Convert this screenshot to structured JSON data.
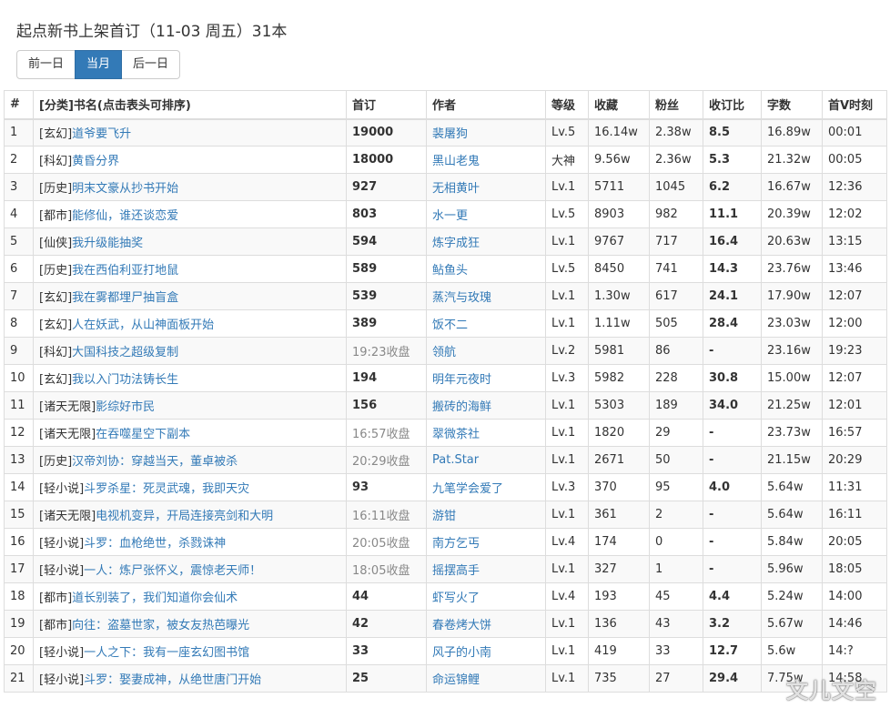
{
  "header": {
    "title": "起点新书上架首订（11-03 周五）31本"
  },
  "nav": {
    "prev_label": "前一日",
    "month_label": "当月",
    "next_label": "后一日"
  },
  "table": {
    "columns": [
      "#",
      "[分类]书名(点击表头可排序)",
      "首订",
      "作者",
      "等级",
      "收藏",
      "粉丝",
      "收订比",
      "字数",
      "首V时刻"
    ],
    "rows": [
      {
        "n": "1",
        "cat": "[玄幻]",
        "name": "道爷要飞升",
        "first": "19000",
        "closed": false,
        "author": "裴屠狗",
        "level": "Lv.5",
        "fav": "16.14w",
        "fans": "2.38w",
        "ratio": "8.5",
        "words": "16.89w",
        "time": "00:01"
      },
      {
        "n": "2",
        "cat": "[科幻]",
        "name": "黄昏分界",
        "first": "18000",
        "closed": false,
        "author": "黑山老鬼",
        "level": "大神",
        "fav": "9.56w",
        "fans": "2.36w",
        "ratio": "5.3",
        "words": "21.32w",
        "time": "00:05"
      },
      {
        "n": "3",
        "cat": "[历史]",
        "name": "明末文豪从抄书开始",
        "first": "927",
        "closed": false,
        "author": "无相黄叶",
        "level": "Lv.1",
        "fav": "5711",
        "fans": "1045",
        "ratio": "6.2",
        "words": "16.67w",
        "time": "12:36"
      },
      {
        "n": "4",
        "cat": "[都市]",
        "name": "能修仙，谁还谈恋爱",
        "first": "803",
        "closed": false,
        "author": "水一更",
        "level": "Lv.5",
        "fav": "8903",
        "fans": "982",
        "ratio": "11.1",
        "words": "20.39w",
        "time": "12:02"
      },
      {
        "n": "5",
        "cat": "[仙侠]",
        "name": "我升级能抽奖",
        "first": "594",
        "closed": false,
        "author": "炼字成狂",
        "level": "Lv.1",
        "fav": "9767",
        "fans": "717",
        "ratio": "16.4",
        "words": "20.63w",
        "time": "13:15"
      },
      {
        "n": "6",
        "cat": "[历史]",
        "name": "我在西伯利亚打地鼠",
        "first": "589",
        "closed": false,
        "author": "鲇鱼头",
        "level": "Lv.5",
        "fav": "8450",
        "fans": "741",
        "ratio": "14.3",
        "words": "23.76w",
        "time": "13:46"
      },
      {
        "n": "7",
        "cat": "[玄幻]",
        "name": "我在雾都埋尸抽盲盒",
        "first": "539",
        "closed": false,
        "author": "蒸汽与玫瑰",
        "level": "Lv.1",
        "fav": "1.30w",
        "fans": "617",
        "ratio": "24.1",
        "words": "17.90w",
        "time": "12:07"
      },
      {
        "n": "8",
        "cat": "[玄幻]",
        "name": "人在妖武，从山神面板开始",
        "first": "389",
        "closed": false,
        "author": "饭不二",
        "level": "Lv.1",
        "fav": "1.11w",
        "fans": "505",
        "ratio": "28.4",
        "words": "23.03w",
        "time": "12:00"
      },
      {
        "n": "9",
        "cat": "[科幻]",
        "name": "大国科技之超级复制",
        "first": "19:23收盘",
        "closed": true,
        "author": "领航",
        "level": "Lv.2",
        "fav": "5981",
        "fans": "86",
        "ratio": "-",
        "words": "23.16w",
        "time": "19:23"
      },
      {
        "n": "10",
        "cat": "[玄幻]",
        "name": "我以入门功法铸长生",
        "first": "194",
        "closed": false,
        "author": "明年元夜时",
        "level": "Lv.3",
        "fav": "5982",
        "fans": "228",
        "ratio": "30.8",
        "words": "15.00w",
        "time": "12:07"
      },
      {
        "n": "11",
        "cat": "[诸天无限]",
        "name": "影综好市民",
        "first": "156",
        "closed": false,
        "author": "搬砖的海鲜",
        "level": "Lv.1",
        "fav": "5303",
        "fans": "189",
        "ratio": "34.0",
        "words": "21.25w",
        "time": "12:01"
      },
      {
        "n": "12",
        "cat": "[诸天无限]",
        "name": "在吞噬星空下副本",
        "first": "16:57收盘",
        "closed": true,
        "author": "翠微茶社",
        "level": "Lv.1",
        "fav": "1820",
        "fans": "29",
        "ratio": "-",
        "words": "23.73w",
        "time": "16:57"
      },
      {
        "n": "13",
        "cat": "[历史]",
        "name": "汉帝刘协：穿越当天，董卓被杀",
        "first": "20:29收盘",
        "closed": true,
        "author": "Pat.Star",
        "level": "Lv.1",
        "fav": "2671",
        "fans": "50",
        "ratio": "-",
        "words": "21.15w",
        "time": "20:29"
      },
      {
        "n": "14",
        "cat": "[轻小说]",
        "name": "斗罗杀星：死灵武魂，我即天灾",
        "first": "93",
        "closed": false,
        "author": "九笔学会爱了",
        "level": "Lv.3",
        "fav": "370",
        "fans": "95",
        "ratio": "4.0",
        "words": "5.64w",
        "time": "11:31"
      },
      {
        "n": "15",
        "cat": "[诸天无限]",
        "name": "电视机变异，开局连接亮剑和大明",
        "first": "16:11收盘",
        "closed": true,
        "author": "游钳",
        "level": "Lv.1",
        "fav": "361",
        "fans": "2",
        "ratio": "-",
        "words": "5.64w",
        "time": "16:11"
      },
      {
        "n": "16",
        "cat": "[轻小说]",
        "name": "斗罗：血枪绝世，杀戮诛神",
        "first": "20:05收盘",
        "closed": true,
        "author": "南方乞丐",
        "level": "Lv.4",
        "fav": "174",
        "fans": "0",
        "ratio": "-",
        "words": "5.84w",
        "time": "20:05"
      },
      {
        "n": "17",
        "cat": "[轻小说]",
        "name": "一人：炼尸张怀义，震惊老天师！",
        "first": "18:05收盘",
        "closed": true,
        "author": "摇摆高手",
        "level": "Lv.1",
        "fav": "327",
        "fans": "1",
        "ratio": "-",
        "words": "5.96w",
        "time": "18:05"
      },
      {
        "n": "18",
        "cat": "[都市]",
        "name": "道长别装了，我们知道你会仙术",
        "first": "44",
        "closed": false,
        "author": "虾写火了",
        "level": "Lv.4",
        "fav": "193",
        "fans": "45",
        "ratio": "4.4",
        "words": "5.24w",
        "time": "14:00"
      },
      {
        "n": "19",
        "cat": "[都市]",
        "name": "向往：盗墓世家，被女友热芭曝光",
        "first": "42",
        "closed": false,
        "author": "春卷烤大饼",
        "level": "Lv.1",
        "fav": "136",
        "fans": "43",
        "ratio": "3.2",
        "words": "5.67w",
        "time": "14:46"
      },
      {
        "n": "20",
        "cat": "[轻小说]",
        "name": "一人之下：我有一座玄幻图书馆",
        "first": "33",
        "closed": false,
        "author": "风子的小南",
        "level": "Lv.1",
        "fav": "419",
        "fans": "33",
        "ratio": "12.7",
        "words": "5.6w",
        "time": "14:?"
      },
      {
        "n": "21",
        "cat": "[轻小说]",
        "name": "斗罗：娶妻成神，从绝世唐门开始",
        "first": "25",
        "closed": false,
        "author": "命运锦鲤",
        "level": "Lv.1",
        "fav": "735",
        "fans": "27",
        "ratio": "29.4",
        "words": "7.75w",
        "time": "14:58"
      }
    ]
  },
  "watermark": {
    "text": "文儿文空"
  }
}
